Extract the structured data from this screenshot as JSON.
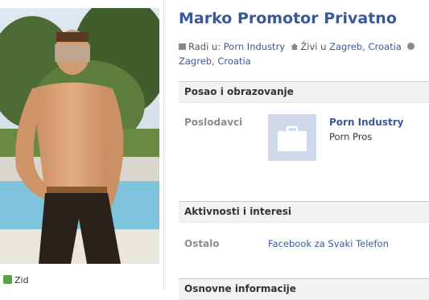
{
  "profile": {
    "name": "Marko Promotor Privatno",
    "works_prefix": "Radi u:",
    "works_at": "Porn Industry",
    "lives_prefix": "Živi u",
    "lives_in": "Zagreb, Croatia",
    "hometown": "Zagreb, Croatia"
  },
  "sections": {
    "work": {
      "title": "Posao i obrazovanje",
      "label": "Poslodavci",
      "company": "Porn Industry",
      "company_sub": "Porn Pros"
    },
    "activities": {
      "title": "Aktivnosti i interesi",
      "label": "Ostalo",
      "value": "Facebook za Svaki Telefon"
    },
    "next": {
      "title": "Osnovne informacije"
    }
  },
  "left": {
    "wall_label": "Zid"
  },
  "colors": {
    "link": "#3b5998",
    "section_bg": "#f2f2f2",
    "company_icon_bg": "#cfd8e8"
  }
}
